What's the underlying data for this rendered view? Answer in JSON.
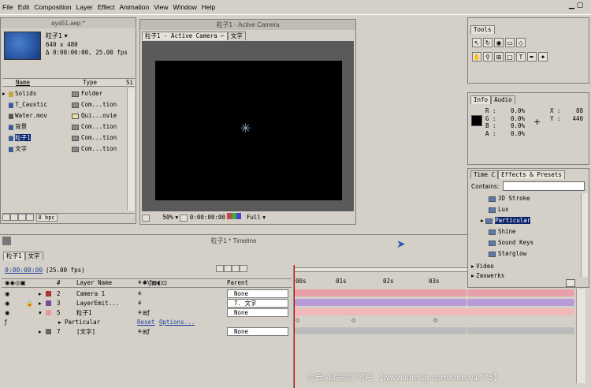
{
  "menu": [
    "File",
    "Edit",
    "Composition",
    "Layer",
    "Effect",
    "Animation",
    "View",
    "Window",
    "Help"
  ],
  "project": {
    "title": "aya51.aep *",
    "comp_name": "粒子1 ▾",
    "comp_size": "640 x 480",
    "comp_duration": "Δ 0:00:06:00, 25.00 fps",
    "col_name": "Name",
    "col_type": "Type",
    "col_size": "Si",
    "items": [
      {
        "name": "Solids",
        "type": "Folder",
        "color": "#8a8a8a"
      },
      {
        "name": "T_Caustic",
        "type": "Com...tion",
        "color": "#8a8a8a"
      },
      {
        "name": "Water.mov",
        "type": "Qui...ovie",
        "color": "#e8e0a0"
      },
      {
        "name": "背景",
        "type": "Com...tion",
        "color": "#8a8a8a"
      },
      {
        "name": "粒子1",
        "type": "Com...tion",
        "color": "#8a8a8a"
      },
      {
        "name": "文字",
        "type": "Com...tion",
        "color": "#8a8a8a"
      }
    ],
    "bpc": "8 bpc"
  },
  "comp_window": {
    "title": "粒子1 - Active Camera",
    "tab1": "粒子1 - Active Camera ⌐",
    "tab2": "文字",
    "zoom": "50%",
    "timecode": "0:00:00:00",
    "resolution": "Full"
  },
  "tools": {
    "title": "Tools"
  },
  "info": {
    "tab1": "Info",
    "tab2": "Audio",
    "r": "R :",
    "rv": "0.0%",
    "g": "G :",
    "gv": "0.0%",
    "b": "B :",
    "bv": "0.0%",
    "a": "A :",
    "av": "0.0%",
    "x": "X :",
    "xv": "88",
    "y": "Y :",
    "yv": "440"
  },
  "effects": {
    "tab1": "Time C",
    "tab2": "Effects & Presets",
    "contains": "Contains:",
    "items": [
      "3D Stroke",
      "Lux",
      "Particular",
      "Shine",
      "Sound Keys",
      "Starglow"
    ],
    "folders": [
      "Video",
      "Zaxwerks"
    ]
  },
  "timeline": {
    "title": "粒子1 * Timeline",
    "tab1": "粒子1",
    "tab2": "文字",
    "timecode": "0:00:00:00",
    "fps": "(25.00 fps)",
    "col_num": "#",
    "col_layer": "Layer Name",
    "col_parent": "Parent",
    "ruler": [
      "00s",
      "01s",
      "02s",
      "03s"
    ],
    "layers": [
      {
        "num": "2",
        "name": "Camera 1",
        "parent": "None",
        "color": "#a33"
      },
      {
        "num": "3",
        "name": "LayerEmit...",
        "parent": "7. 文字",
        "color": "#7a4a9a"
      },
      {
        "num": "5",
        "name": "粒子1",
        "parent": "None",
        "color": "#c66"
      },
      {
        "num": "",
        "name": "Particular",
        "parent": "",
        "color": ""
      },
      {
        "num": "7",
        "name": "[文字]",
        "parent": "None",
        "color": "#666"
      }
    ],
    "reset": "Reset",
    "options": "Options..."
  },
  "watermark": "雪云AE后期学习吧 【www.lineCg.com/tieba/1775】"
}
